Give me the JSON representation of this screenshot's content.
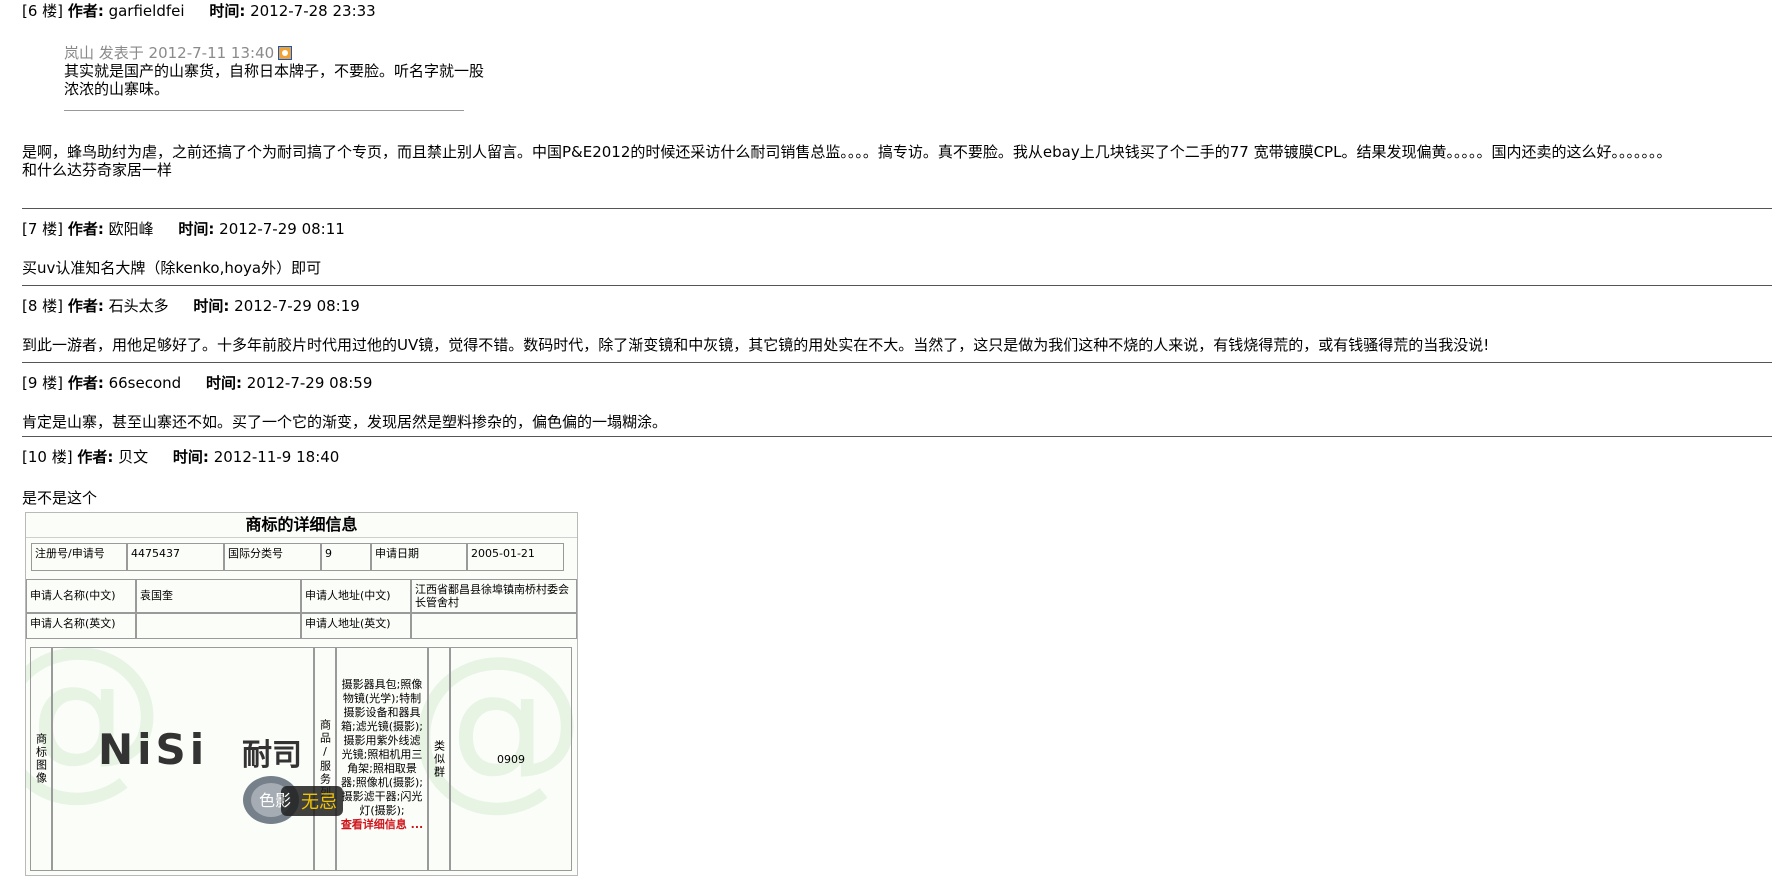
{
  "labels": {
    "author": "作者:",
    "time": "时间:"
  },
  "posts": [
    {
      "floor": "[6 楼]",
      "author": "garfieldfei",
      "time": "2012-7-28 23:33",
      "quote": {
        "meta": "岚山 发表于 2012-7-11 13:40",
        "text": "其实就是国产的山寨货，自称日本牌子，不要脸。听名字就一股浓浓的山寨味。"
      },
      "body": [
        "是啊，蜂鸟助纣为虐，之前还搞了个为耐司搞了个专页，而且禁止别人留言。中国P&E2012的时候还采访什么耐司销售总监。。。。搞专访。真不要脸。我从ebay上几块钱买了个二手的77 宽带镀膜CPL。结果发现偏黄。。。。。国内还卖的这么好。。。。。。。",
        "和什么达芬奇家居一样"
      ]
    },
    {
      "floor": "[7 楼]",
      "author": "欧阳峰",
      "time": "2012-7-29 08:11",
      "body": [
        "买uv认准知名大牌（除kenko,hoya外）即可"
      ]
    },
    {
      "floor": "[8 楼]",
      "author": "石头太多",
      "time": "2012-7-29 08:19",
      "body": [
        "到此一游者，用他足够好了。十多年前胶片时代用过他的UV镜，觉得不错。数码时代，除了渐变镜和中灰镜，其它镜的用处实在不大。当然了，这只是做为我们这种不烧的人来说，有钱烧得荒的，或有钱骚得荒的当我没说!"
      ]
    },
    {
      "floor": "[9 楼]",
      "author": "66second",
      "time": "2012-7-29 08:59",
      "body": [
        "肯定是山寨，甚至山寨还不如。买了一个它的渐变，发现居然是塑料掺杂的，偏色偏的一塌糊涂。"
      ]
    },
    {
      "floor": "[10 楼]",
      "author": "贝文",
      "time": "2012-11-9 18:40",
      "body": [
        "是不是这个"
      ]
    }
  ],
  "trademark": {
    "title": "商标的详细信息",
    "reg_no_label": "注册号/申请号",
    "reg_no": "4475437",
    "class_label": "国际分类号",
    "class": "9",
    "date_label": "申请日期",
    "date": "2005-01-21",
    "name_cn_label": "申请人名称(中文)",
    "name_cn": "袁国奎",
    "addr_cn_label": "申请人地址(中文)",
    "addr_cn": "江西省鄱昌县徐埠镇南桥村委会长管舍村",
    "name_en_label": "申请人名称(英文)",
    "addr_en_label": "申请人地址(英文)",
    "image_label": "商标图像",
    "goods_label": "商品/服务列",
    "goods": "摄影器具包;照像物镜(光学);特制摄影设备和器具箱;滤光镜(摄影);摄影用紫外线滤光镜;照相机用三角架;照相取景器;照像机(摄影);摄影滤干器;闪光灯(摄影);",
    "more": "查看详细信息 ...",
    "group_label": "类似群",
    "group": "0909",
    "logo_text": "NiSi",
    "logo_cn": "耐司",
    "watermark": "色影无忌"
  }
}
